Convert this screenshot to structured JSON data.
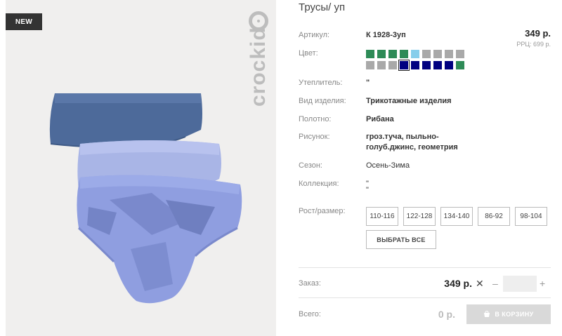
{
  "badge": "NEW",
  "brand": "crockid",
  "product": {
    "title": "Трусы/ уп",
    "price": "349 р.",
    "rrp": "РРЦ: 699 р."
  },
  "details": {
    "article_label": "Артикул:",
    "article_value": "К 1928-3уп",
    "color_label": "Цвет:",
    "insulation_label": "Утеплитель:",
    "insulation_value": "\"",
    "type_label": "Вид изделия:",
    "type_value": "Трикотажные изделия",
    "fabric_label": "Полотно:",
    "fabric_value": "Рибана",
    "pattern_label": "Рисунок:",
    "pattern_line1": "гроз.туча, пыльно-",
    "pattern_line2": "голуб.джинс, геометрия",
    "season_label": "Сезон:",
    "season_value": "Осень-Зима",
    "collection_label": "Коллекция:",
    "collection_line1": "\"",
    "collection_line2": "\"",
    "size_label": "Рост/размер:"
  },
  "colors": [
    "#2e8b57",
    "#2e8b57",
    "#2e8b57",
    "#2e8b57",
    "#87ceeb",
    "#a9a9a9",
    "#a9a9a9",
    "#a9a9a9",
    "#a9a9a9",
    "#a9a9a9",
    "#a9a9a9",
    "#a9a9a9",
    "#000080",
    "#000080",
    "#000080",
    "#000080",
    "#000080",
    "#2e8b57"
  ],
  "selected_color_index": 12,
  "sizes": [
    "110-116",
    "122-128",
    "134-140",
    "86-92",
    "98-104"
  ],
  "select_all": "ВЫБРАТЬ ВСЕ",
  "order": {
    "label": "Заказ:",
    "price": "349 р.",
    "times": "✕",
    "minus": "–",
    "plus": "+",
    "quantity": ""
  },
  "total": {
    "label": "Всего:",
    "value": "0 р."
  },
  "cart_button": "В КОРЗИНУ"
}
